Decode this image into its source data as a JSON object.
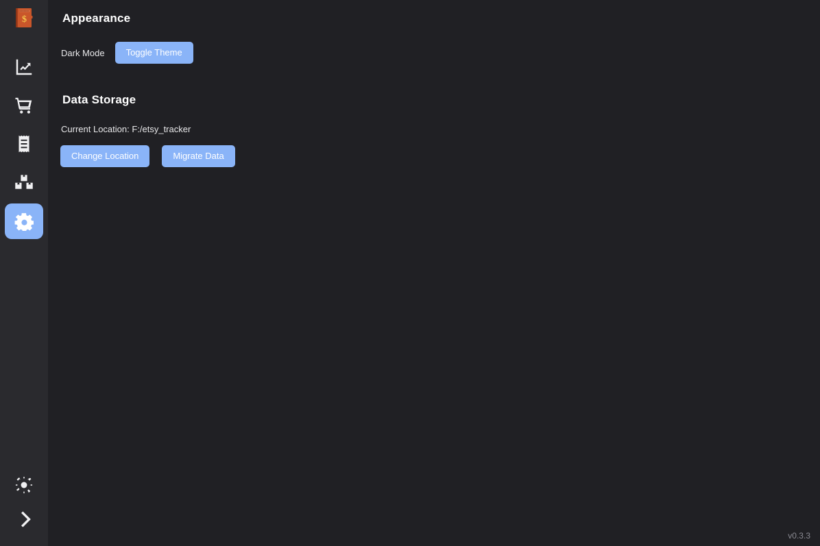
{
  "app": {
    "logo_icon": "ledger-dollar-book-icon",
    "version": "v0.3.3",
    "accent_color": "#8ab4f8",
    "sidebar_bg": "#2a2a2e",
    "main_bg": "#202024",
    "logo_color": "#c0552a"
  },
  "sidebar": {
    "items": [
      {
        "id": "analytics",
        "icon": "chart-line-up-icon",
        "label": "Analytics",
        "active": false
      },
      {
        "id": "sales",
        "icon": "shopping-cart-icon",
        "label": "Sales",
        "active": false
      },
      {
        "id": "expenses",
        "icon": "receipt-icon",
        "label": "Expenses",
        "active": false
      },
      {
        "id": "inventory",
        "icon": "boxes-icon",
        "label": "Inventory",
        "active": false
      },
      {
        "id": "settings",
        "icon": "gear-icon",
        "label": "Settings",
        "active": true
      }
    ],
    "bottom_items": [
      {
        "id": "theme-toggle",
        "icon": "sun-icon",
        "label": "Light Mode"
      },
      {
        "id": "expand-sidebar",
        "icon": "chevron-right-icon",
        "label": "Expand"
      }
    ]
  },
  "main": {
    "appearance": {
      "heading": "Appearance",
      "dark_mode_label": "Dark Mode",
      "toggle_theme_label": "Toggle Theme"
    },
    "data_storage": {
      "heading": "Data Storage",
      "current_location": "Current Location: F:/etsy_tracker",
      "change_location_label": "Change Location",
      "migrate_data_label": "Migrate Data"
    }
  }
}
